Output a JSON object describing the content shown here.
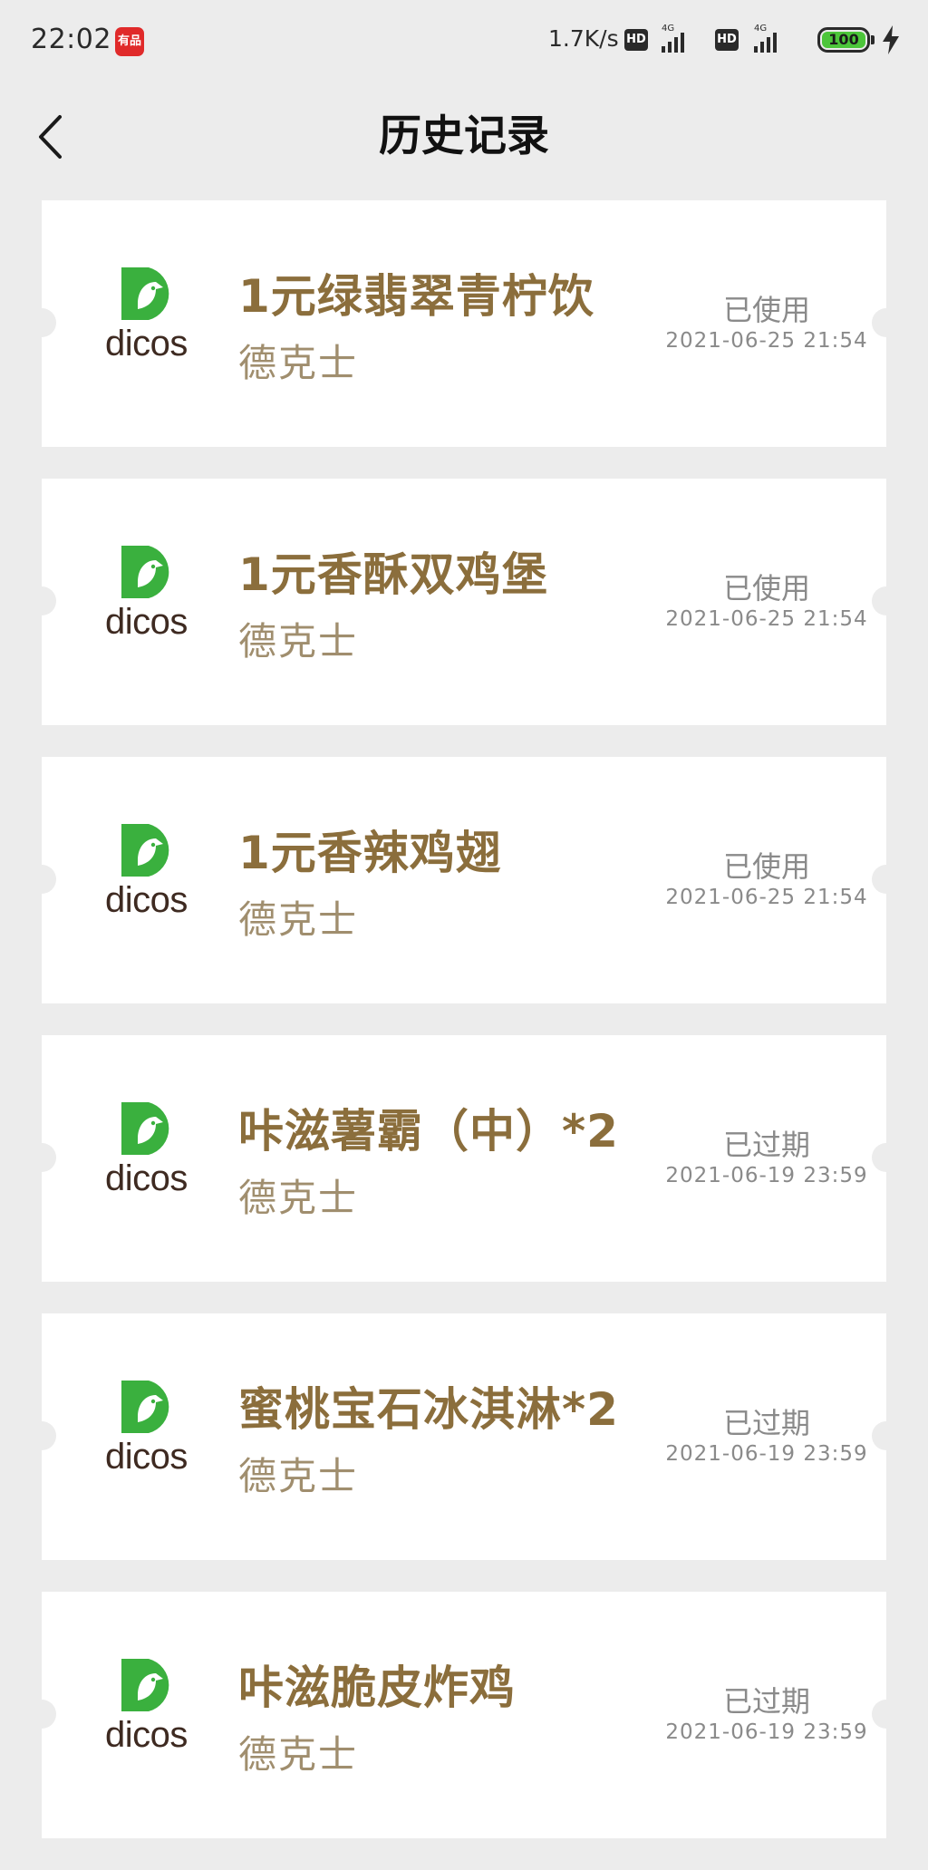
{
  "status_bar": {
    "time": "22:02",
    "app_badge": "有品",
    "net_speed": "1.7K/s",
    "hd_label": "HD",
    "signal_tag": "4G",
    "battery": "100"
  },
  "header": {
    "title": "历史记录"
  },
  "logo_word": "dicos",
  "brand_color": "#3ab03e",
  "title_color": "#8b6e3c",
  "coupons": [
    {
      "title": "1元绿翡翠青柠饮",
      "brand": "德克士",
      "status": "已使用",
      "time": "2021-06-25 21:54"
    },
    {
      "title": "1元香酥双鸡堡",
      "brand": "德克士",
      "status": "已使用",
      "time": "2021-06-25 21:54"
    },
    {
      "title": "1元香辣鸡翅",
      "brand": "德克士",
      "status": "已使用",
      "time": "2021-06-25 21:54"
    },
    {
      "title": "咔滋薯霸（中）*2",
      "brand": "德克士",
      "status": "已过期",
      "time": "2021-06-19 23:59"
    },
    {
      "title": "蜜桃宝石冰淇淋*2",
      "brand": "德克士",
      "status": "已过期",
      "time": "2021-06-19 23:59"
    },
    {
      "title": "咔滋脆皮炸鸡",
      "brand": "德克士",
      "status": "已过期",
      "time": "2021-06-19 23:59"
    }
  ]
}
